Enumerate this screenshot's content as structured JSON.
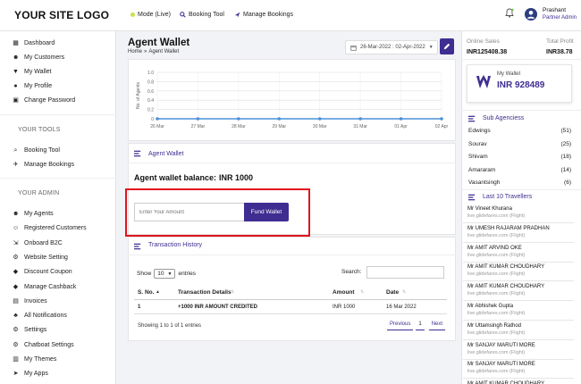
{
  "brand": {
    "logo": "YOUR SITE LOGO"
  },
  "topnav": {
    "mode": "Mode (Live)",
    "booking_tool": "Booking Tool",
    "manage_bookings": "Manage Bookings"
  },
  "user": {
    "name": "Prashant",
    "role": "Partner Admin"
  },
  "sidebar": {
    "main": [
      {
        "label": "Dashboard",
        "icon": "dashboard-icon"
      },
      {
        "label": "My Customers",
        "icon": "users-icon"
      },
      {
        "label": "My Wallet",
        "icon": "wallet-icon"
      },
      {
        "label": "My Profile",
        "icon": "user-icon"
      },
      {
        "label": "Change Password",
        "icon": "lock-icon"
      }
    ],
    "tools_heading": "YOUR TOOLS",
    "tools": [
      {
        "label": "Booking Tool",
        "icon": "search-icon"
      },
      {
        "label": "Manage Bookings",
        "icon": "plane-icon"
      }
    ],
    "admin_heading": "YOUR ADMIN",
    "admin": [
      {
        "label": "My Agents",
        "icon": "agents-icon"
      },
      {
        "label": "Registered Customers",
        "icon": "customers-icon"
      },
      {
        "label": "Onboard B2C",
        "icon": "onboard-icon"
      },
      {
        "label": "Website Setting",
        "icon": "gear-icon"
      },
      {
        "label": "Discount Coupon",
        "icon": "tag-icon"
      },
      {
        "label": "Manage Cashback",
        "icon": "tags-icon"
      },
      {
        "label": "Invoices",
        "icon": "invoice-icon"
      },
      {
        "label": "All Notifications",
        "icon": "bell-icon"
      },
      {
        "label": "Settings",
        "icon": "settings-icon"
      },
      {
        "label": "Chatboat Settings",
        "icon": "chat-gear-icon"
      },
      {
        "label": "My Themes",
        "icon": "themes-icon"
      },
      {
        "label": "My Apps",
        "icon": "send-icon"
      }
    ]
  },
  "page": {
    "title": "Agent Wallet",
    "breadcrumb_home": "Home",
    "breadcrumb_sep": "»",
    "breadcrumb_current": "Agent Wallet",
    "date_range": "26-Mar-2022 : 02-Apr-2022"
  },
  "chart_data": {
    "type": "line",
    "x": [
      "26 Mar",
      "27 Mar",
      "28 Mar",
      "29 Mar",
      "30 Mar",
      "31 Mar",
      "01 Apr",
      "02 Apr"
    ],
    "series": [
      {
        "values": [
          0,
          0,
          0,
          0,
          0,
          0,
          0,
          0
        ]
      }
    ],
    "ylabel": "No. of Agents",
    "yticks": [
      "1.0",
      "0.8",
      "0.6",
      "0.4",
      "0.2",
      "0"
    ],
    "ylim": [
      0,
      1
    ],
    "grid": true,
    "color": "#4a90d9"
  },
  "wallet": {
    "section_title": "Agent Wallet",
    "balance_label": "Agent wallet balance:",
    "balance_value": "INR 1000",
    "amount_placeholder": "Enter Your Amount",
    "fund_button": "Fund Wallet"
  },
  "transactions": {
    "section_title": "Transaction History",
    "show_label": "Show",
    "entries_value": "10",
    "entries_label": "entries",
    "search_label": "Search:",
    "columns": [
      "S. No.",
      "Transaction Details",
      "Amount",
      "Date"
    ],
    "rows": [
      {
        "sno": "1",
        "details": "+1000 INR AMOUNT CREDITED",
        "amount": "INR 1000",
        "date": "16 Mar 2022"
      }
    ],
    "info": "Showing 1 to 1 of 1 entries",
    "prev": "Previous",
    "page": "1",
    "next": "Next"
  },
  "stats": {
    "online_sales_label": "Online Sales",
    "online_sales_value": "INR125408.38",
    "total_profit_label": "Total Profit",
    "total_profit_value": "INR38.78"
  },
  "my_wallet_card": {
    "label": "My Wallet",
    "value": "INR 928489"
  },
  "sub_agencies": {
    "title": "Sub Agenciess",
    "items": [
      {
        "name": "Edwings",
        "count": "(51)"
      },
      {
        "name": "Sourav",
        "count": "(25)"
      },
      {
        "name": "Shivam",
        "count": "(18)"
      },
      {
        "name": "Amararam",
        "count": "(14)"
      },
      {
        "name": "Vasantsingh",
        "count": "(6)"
      }
    ]
  },
  "travellers": {
    "title": "Last 10 Travellers",
    "items": [
      {
        "name": "Mr Vineet Khurana",
        "sub": "live.glidefares.com (Flight)"
      },
      {
        "name": "Mr UMESH RAJARAM PRADHAN",
        "sub": "live.glidefares.com (Flight)"
      },
      {
        "name": "Mr AMIT ARVIND OKE",
        "sub": "live.glidefares.com (Flight)"
      },
      {
        "name": "Mr AMIT KUMAR CHOUDHARY",
        "sub": "live.glidefares.com (Flight)"
      },
      {
        "name": "Mr AMIT KUMAR CHOUDHARY",
        "sub": "live.glidefares.com (Flight)"
      },
      {
        "name": "Mr Abhishek Gupta",
        "sub": "live.glidefares.com (Flight)"
      },
      {
        "name": "Mr Uttamsingh Rathod",
        "sub": "live.glidefares.com (Flight)"
      },
      {
        "name": "Mr SANJAY MARUTI MORE",
        "sub": "live.glidefares.com (Flight)"
      },
      {
        "name": "Mr SANJAY MARUTI MORE",
        "sub": "live.glidefares.com (Flight)"
      },
      {
        "name": "Mr AMIT KUMAR CHOUDHARY",
        "sub": ""
      }
    ]
  },
  "colors": {
    "accent": "#3f2d91",
    "highlight": "#e0141e",
    "line": "#4a90d9"
  }
}
